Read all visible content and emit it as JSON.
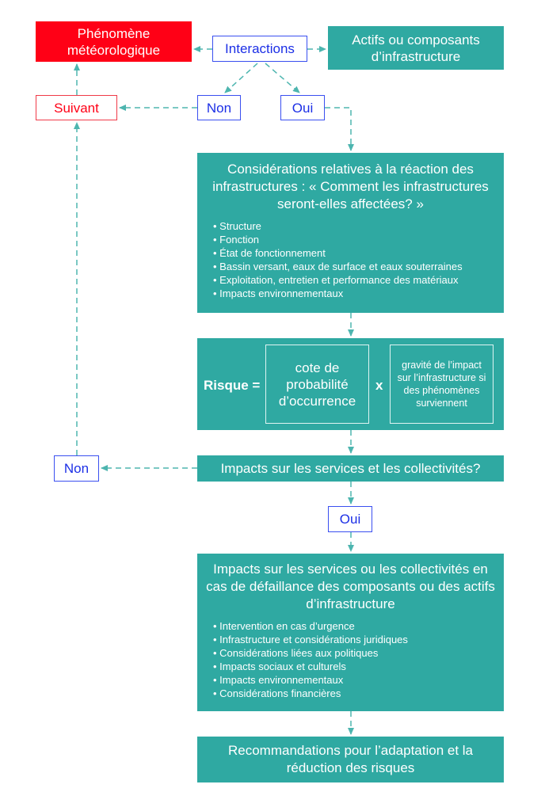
{
  "colors": {
    "teal": "#2fa9a2",
    "red": "#ff0016",
    "blue": "#1c2fe6",
    "connector": "#2fa9a2"
  },
  "nodes": {
    "phenomene": "Phénomène météorologique",
    "interactions": "Interactions",
    "actifs": "Actifs ou composants d’infrastructure",
    "suivant": "Suivant",
    "non_1": "Non",
    "oui_1": "Oui",
    "reaction": {
      "title": "Considérations relatives à la réaction des infrastructures : « Comment les infrastructures seront-elles affectées? »",
      "items": [
        "Structure",
        "Fonction",
        "État de fonctionnement",
        "Bassin versant, eaux de surface et eaux souterraines",
        "Exploitation, entretien et performance des matériaux",
        "Impacts environnementaux"
      ]
    },
    "risque": {
      "label": "Risque =",
      "probabilite": "cote de probabilité d’occurrence",
      "operator": "x",
      "gravite": "gravité de l’impact sur l’infrastructure si des phénomènes surviennent"
    },
    "impacts_question": "Impacts sur les services et les collectivités?",
    "non_2": "Non",
    "oui_2": "Oui",
    "impacts_defaillance": {
      "title": "Impacts sur les services ou les collectivités en cas de défaillance des composants ou des actifs d’infrastructure",
      "items": [
        "Intervention en cas d’urgence",
        "Infrastructure et considérations juridiques",
        "Considérations liées aux politiques",
        "Impacts sociaux et culturels",
        "Impacts environnementaux",
        "Considérations financières"
      ]
    },
    "recommandations": "Recommandations pour l’adaptation et la réduction des risques"
  }
}
